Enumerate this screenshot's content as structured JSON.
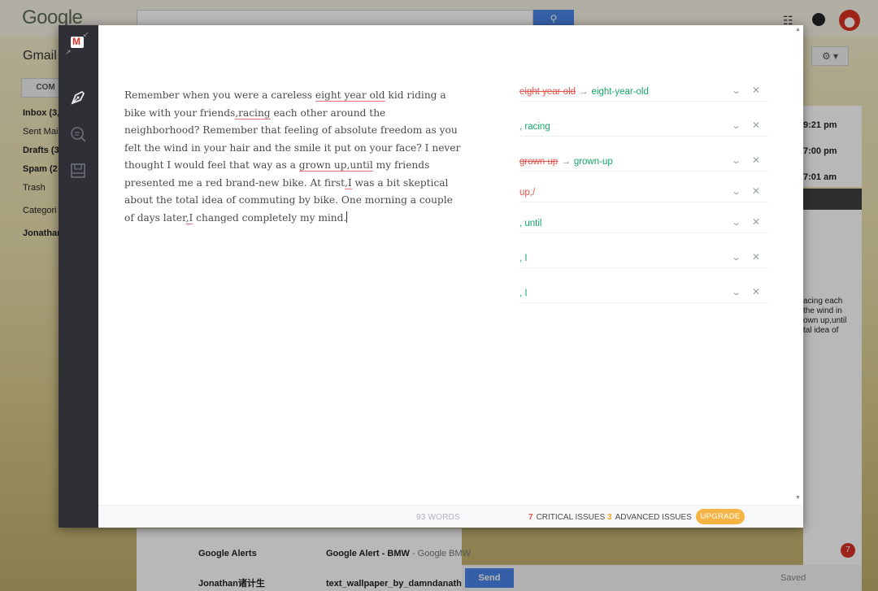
{
  "background": {
    "logo": "Google",
    "app_label": "Gmail",
    "compose_label": "COM",
    "sidebar": [
      "Inbox (3,",
      "Sent Mail",
      "Drafts (3",
      "Spam (2",
      "Trash",
      "Categori",
      "Jonathan"
    ],
    "times": [
      "9:21 pm",
      "7:00 pm",
      "7:01 am"
    ],
    "compose_snippet": [
      "acing each",
      "the wind in",
      "own up,until",
      "tal idea of"
    ],
    "rows": [
      {
        "sender": "Google Alerts",
        "subject": "Google Alert - BMW",
        "preview": " - Google BMW"
      },
      {
        "sender": "Jonathan诸计生",
        "subject": "text_wallpaper_by_damndanatha",
        "preview": ""
      }
    ],
    "send_label": "Send",
    "saved_label": "Saved",
    "badge": "7"
  },
  "editor": {
    "text": {
      "p1": "Remember when you were a careless ",
      "e1": "eight year old",
      "p2": " kid riding a bike with your friends",
      "e2": ",racing",
      "p3": " each other around the neighborhood? Remember that feeling of absolute freedom as you felt the wind in your hair and the smile it put on your face? I never thought I would feel that way as a ",
      "e3": "grown up,until",
      "p4": " my friends presented me a red brand-new bike. At first",
      "e4": ",I",
      "p5": " was a bit skeptical about the total idea of commuting by bike. One morning a couple of days later",
      "e5": ",I",
      "p6": " changed completely my mind."
    },
    "issues": [
      {
        "del": "eight year old",
        "arrow": "→",
        "add": "eight-year-old"
      },
      {
        "add": ", racing"
      },
      {
        "del": "grown up",
        "arrow": "→",
        "add": "grown-up"
      },
      {
        "wrong": "up,/"
      },
      {
        "add": ", until"
      },
      {
        "add": ", I"
      },
      {
        "add": ", I"
      }
    ],
    "status": {
      "words": "93 WORDS",
      "critical_count": "7",
      "critical_label": "CRITICAL ISSUES",
      "advanced_count": "3",
      "advanced_label": "ADVANCED ISSUES",
      "upgrade": "UPGRADE"
    }
  },
  "colors": {
    "error": "#e5534b",
    "fix": "#16a765",
    "advanced": "#f5a623",
    "sidebar": "#2e3036"
  }
}
